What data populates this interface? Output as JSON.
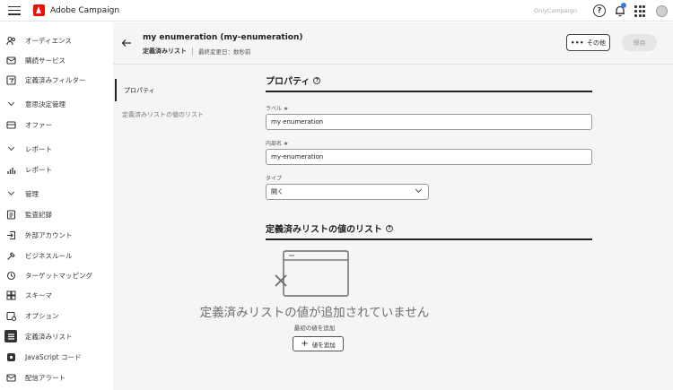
{
  "app": {
    "name": "Adobe Campaign",
    "org": "OnlyCampaign"
  },
  "sidebar": {
    "items": [
      {
        "label": "オーディエンス",
        "icon": "audience-icon",
        "section": false
      },
      {
        "label": "購読サービス",
        "icon": "subscription-icon",
        "section": false
      },
      {
        "label": "定義済みフィルター",
        "icon": "filter-icon",
        "section": false
      },
      {
        "label": "意思決定管理",
        "icon": "chevron-down-icon",
        "section": true
      },
      {
        "label": "オファー",
        "icon": "offer-icon",
        "section": false
      },
      {
        "label": "レポート",
        "icon": "chevron-down-icon",
        "section": true
      },
      {
        "label": "レポート",
        "icon": "report-icon",
        "section": false
      },
      {
        "label": "管理",
        "icon": "chevron-down-icon",
        "section": true
      },
      {
        "label": "監査記録",
        "icon": "audit-icon",
        "section": false
      },
      {
        "label": "外部アカウント",
        "icon": "external-account-icon",
        "section": false
      },
      {
        "label": "ビジネスルール",
        "icon": "business-rule-icon",
        "section": false
      },
      {
        "label": "ターゲットマッピング",
        "icon": "target-mapping-icon",
        "section": false
      },
      {
        "label": "スキーマ",
        "icon": "schema-icon",
        "section": false
      },
      {
        "label": "オプション",
        "icon": "options-icon",
        "section": false
      },
      {
        "label": "定義済みリスト",
        "icon": "enumeration-icon",
        "section": false,
        "active": true
      },
      {
        "label": "JavaScript コード",
        "icon": "javascript-icon",
        "section": false
      },
      {
        "label": "配信アラート",
        "icon": "alert-icon",
        "section": false
      }
    ]
  },
  "header": {
    "title": "my enumeration (my-enumeration)",
    "subtitle": "定義済みリスト",
    "last_modified": "最終変更日：数秒前",
    "more_label": "その他",
    "save_label": "保存"
  },
  "tabs": [
    {
      "label": "プロパティ",
      "active": true
    },
    {
      "label": "定義済みリストの値のリスト",
      "active": false
    }
  ],
  "properties": {
    "title": "プロパティ",
    "label_field": {
      "label": "ラベル ★",
      "value": "my enumeration"
    },
    "internal_name_field": {
      "label": "内部名 ★",
      "value": "my-enumeration"
    },
    "type_field": {
      "label": "タイプ",
      "value": "開く"
    }
  },
  "values_list": {
    "title": "定義済みリストの値のリスト",
    "empty_title": "定義済みリストの値が追加されていません",
    "empty_subtitle": "最初の値を追加",
    "add_button": "値を追加"
  },
  "colors": {
    "accent": "#eb1000",
    "notification": "#3d7bd9",
    "text": "#222222",
    "muted": "#6e6e6e"
  }
}
